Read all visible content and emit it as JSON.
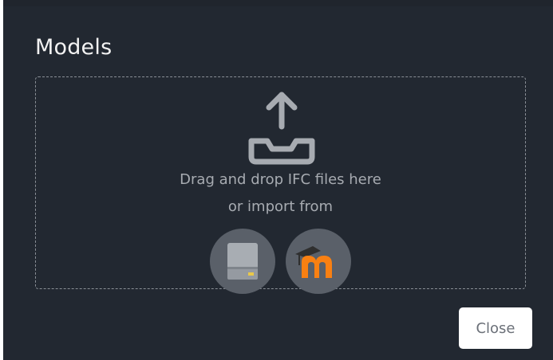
{
  "dialog": {
    "title": "Models",
    "dropzone": {
      "line1": "Drag and drop IFC files here",
      "line2": "or import from",
      "icon": "upload-tray-icon"
    },
    "import_sources": [
      {
        "name": "local-drive",
        "icon": "hard-drive-icon"
      },
      {
        "name": "moodle",
        "icon": "moodle-logo-icon"
      }
    ],
    "close_label": "Close"
  },
  "colors": {
    "background": "#222831",
    "text_muted": "#a7abb1",
    "button_circle": "#5a6069",
    "moodle_orange": "#f98012"
  }
}
